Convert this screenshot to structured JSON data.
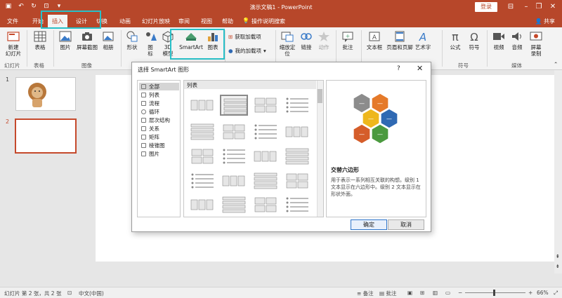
{
  "app": {
    "title": "演示文稿1 - PowerPoint",
    "login": "登录",
    "share": "共享"
  },
  "tabs": [
    "文件",
    "开始",
    "插入",
    "设计",
    "切换",
    "动画",
    "幻灯片放映",
    "审阅",
    "视图",
    "帮助",
    "操作说明搜索"
  ],
  "ribbon": {
    "new_slide": "新建\n幻灯片",
    "table": "表格",
    "pictures": "图片",
    "screenshot": "屏幕截图",
    "album": "相册",
    "shapes": "形状",
    "icons": "图\n标",
    "models_3d": "3D\n模型",
    "smartart": "SmartArt",
    "chart": "图表",
    "get_addins": "获取加载项",
    "my_addins": "我的加载项",
    "zoom": "缩放定\n位",
    "link": "链接",
    "action": "动作",
    "comment": "批注",
    "textbox": "文本框",
    "header_footer": "页眉和页脚",
    "wordart": "艺术字",
    "equation": "公式",
    "symbol": "符号",
    "video": "视频",
    "audio": "音频",
    "screen_record": "屏幕\n录制",
    "groups": {
      "slides": "幻灯片",
      "tables": "表格",
      "images": "图像",
      "symbols": "符号",
      "media": "媒体"
    }
  },
  "slides": [
    {
      "number": "1"
    },
    {
      "number": "2"
    }
  ],
  "dialog": {
    "title": "选择 SmartArt 图形",
    "help": "?",
    "close": "✕",
    "categories": [
      "全部",
      "列表",
      "流程",
      "循环",
      "层次结构",
      "关系",
      "矩阵",
      "棱锥图",
      "图片"
    ],
    "selected_category": "全部",
    "grid_header": "列表",
    "preview_title": "交替六边形",
    "preview_desc": "用于表示一系列相互关联的构想。级别 1 文本显示在六边形中。级别 2 文本显示在形状外面。",
    "ok": "确定",
    "cancel": "取消",
    "hex_colors": [
      "#8c8c8c",
      "#e57a2a",
      "#eeb71c",
      "#2f69b3",
      "#d55d2a",
      "#4b9a3f"
    ],
    "hex_label": "—"
  },
  "status": {
    "slide_info": "幻灯片 第 2 张，共 2 张",
    "language": "中文(中国)",
    "notes": "备注",
    "comments": "批注",
    "zoom": "66%"
  },
  "colors": {
    "accent": "#b7472a",
    "highlight": "#28c0c8"
  }
}
